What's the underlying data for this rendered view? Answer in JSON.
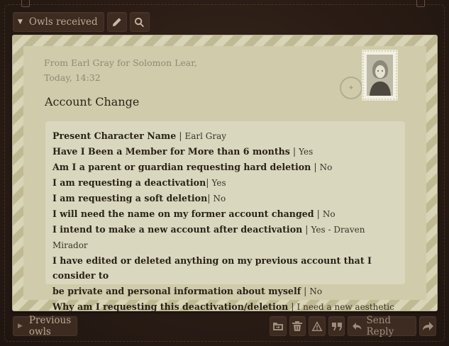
{
  "toolbar": {
    "folder_label": "Owls received"
  },
  "message": {
    "from_line": "From Earl Gray for Solomon Lear,",
    "time_line": "Today, 14:32",
    "subject": "Account Change",
    "lines": [
      {
        "label": "Present Character Name",
        "sep": " | ",
        "answer": "Earl Gray"
      },
      {
        "label": "Have I Been a Member for More than 6 months",
        "sep": " | ",
        "answer": "Yes"
      },
      {
        "label": "Am I a parent or guardian requesting hard deletion",
        "sep": " | ",
        "answer": "No"
      },
      {
        "label": "I am requesting a deactivation",
        "sep": "| ",
        "answer": "Yes"
      },
      {
        "label": "I am requesting a soft deletion",
        "sep": "| ",
        "answer": "No"
      },
      {
        "label": "I will need the name on my former account changed",
        "sep": " | ",
        "answer": "No"
      },
      {
        "label": "I intend to make a new account after deactivation",
        "sep": " | ",
        "answer": "Yes - Draven Mirador"
      },
      {
        "label": "I have edited or deleted anything on my previous account that I consider to",
        "sep": "",
        "answer": ""
      },
      {
        "label": "be private and personal information about myself",
        "sep": " | ",
        "answer": "No"
      },
      {
        "label": "Why am I requesting this deactivation/deletion",
        "sep": " | ",
        "answer": "I need a new aesthetic"
      }
    ]
  },
  "footer": {
    "prev_label": "Previous owls",
    "reply_label": "Send Reply"
  },
  "icons": {
    "dropdown": "caret-down-icon",
    "edit": "pencil-icon",
    "search": "search-icon",
    "move": "folder-move-icon",
    "delete": "trash-icon",
    "report": "warning-icon",
    "quote": "quote-icon",
    "reply": "reply-icon",
    "forward": "forward-icon"
  },
  "colors": {
    "background": "#2b1d16",
    "envelope": "#d8d4b6",
    "paper": "#cfcbab",
    "button": "#3d2b21"
  }
}
